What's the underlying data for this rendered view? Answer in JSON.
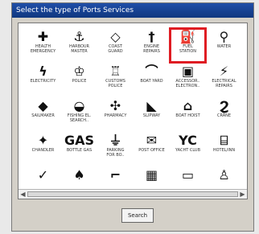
{
  "window": {
    "title": "Select the type of Ports Services"
  },
  "services": [
    {
      "label": "HEALTH\nEMERGENCY",
      "icon": "✚",
      "icon_name": "medical-cross-icon"
    },
    {
      "label": "HARBOUR\nMASTER",
      "icon": "⚓",
      "icon_name": "harbour-master-icon"
    },
    {
      "label": "COAST\nGUARD",
      "icon": "◇",
      "icon_name": "coast-guard-icon"
    },
    {
      "label": "ENGINE\nREPAIRS",
      "icon": "†",
      "icon_name": "engine-repairs-icon"
    },
    {
      "label": "FUEL\nSTATION",
      "icon": "⛽",
      "icon_name": "fuel-station-icon",
      "selected": true
    },
    {
      "label": "WATER",
      "icon": "⚲",
      "icon_name": "water-tap-icon"
    },
    {
      "label": "ELECTRICITY",
      "icon": "ϟ",
      "icon_name": "electricity-icon"
    },
    {
      "label": "POLICE",
      "icon": "♔",
      "icon_name": "police-icon"
    },
    {
      "label": "CUSTOMS\nPOLICE",
      "icon": "♖",
      "icon_name": "customs-police-icon"
    },
    {
      "label": "BOAT YARD",
      "icon": "⌒",
      "icon_name": "boat-yard-icon"
    },
    {
      "label": "ACCESSOR..\nELECTRON..",
      "icon": "▣",
      "icon_name": "electronics-accessories-icon"
    },
    {
      "label": "ELECTRICAL\nREPAIRS",
      "icon": "⚡",
      "icon_name": "electrical-repairs-icon"
    },
    {
      "label": "SAILMAKER",
      "icon": "◆",
      "icon_name": "sailmaker-icon"
    },
    {
      "label": "FISHING EL.\nSEARCH..",
      "icon": "◒",
      "icon_name": "fishing-search-icon"
    },
    {
      "label": "PHARMACY",
      "icon": "✣",
      "icon_name": "pharmacy-icon"
    },
    {
      "label": "SLIPWAY",
      "icon": "◣",
      "icon_name": "slipway-icon"
    },
    {
      "label": "BOAT HOIST",
      "icon": "⌂",
      "icon_name": "boat-hoist-icon"
    },
    {
      "label": "CRANE",
      "icon": "Ϩ",
      "icon_name": "crane-icon"
    },
    {
      "label": "CHANDLER",
      "icon": "✦",
      "icon_name": "chandler-icon"
    },
    {
      "label": "BOTTLE GAS",
      "icon": "GAS",
      "icon_name": "bottle-gas-icon"
    },
    {
      "label": "PARKING\nFOR BO..",
      "icon": "⏚",
      "icon_name": "parking-icon"
    },
    {
      "label": "POST OFFICE",
      "icon": "✉",
      "icon_name": "post-office-icon"
    },
    {
      "label": "YACHT CLUB",
      "icon": "YC",
      "icon_name": "yacht-club-icon"
    },
    {
      "label": "HOTEL/INN",
      "icon": "⌸",
      "icon_name": "hotel-inn-icon"
    },
    {
      "label": "",
      "icon": "✓",
      "icon_name": "partially-visible-icon-1"
    },
    {
      "label": "",
      "icon": "♠",
      "icon_name": "partially-visible-icon-2"
    },
    {
      "label": "",
      "icon": "⌐",
      "icon_name": "partially-visible-icon-3"
    },
    {
      "label": "",
      "icon": "▦",
      "icon_name": "partially-visible-icon-4"
    },
    {
      "label": "",
      "icon": "▭",
      "icon_name": "partially-visible-icon-5"
    },
    {
      "label": "",
      "icon": "♙",
      "icon_name": "partially-visible-icon-6"
    }
  ],
  "buttons": {
    "search": "Search"
  }
}
